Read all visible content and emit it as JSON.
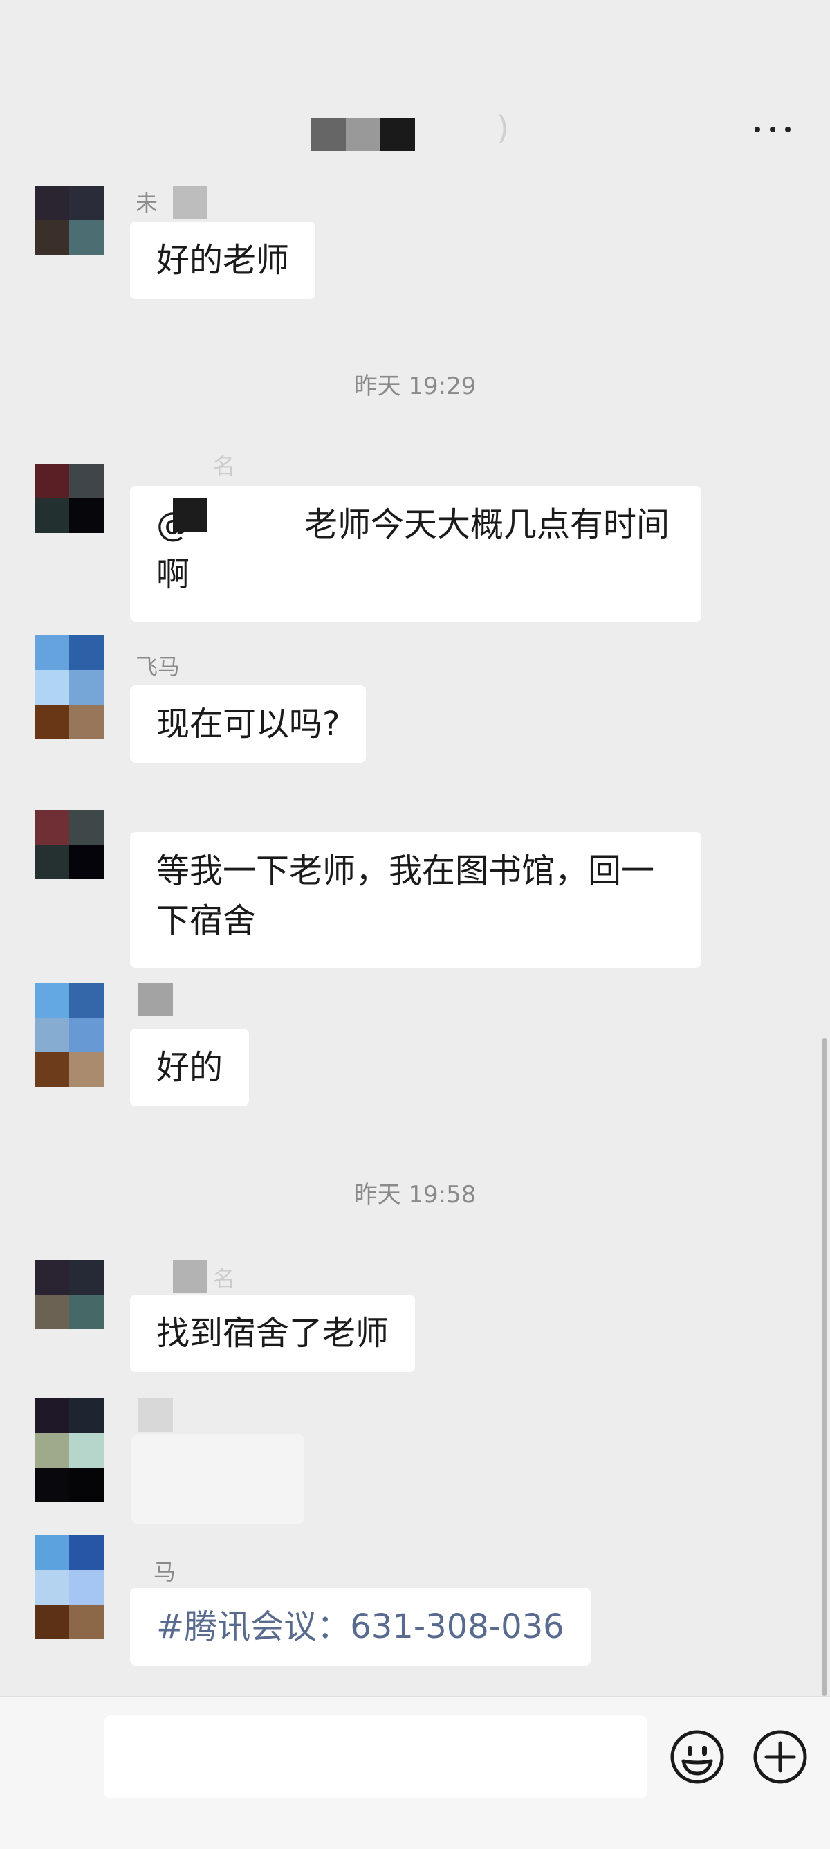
{
  "header": {
    "title_suffix": ")",
    "title_blocks": [
      "#666666",
      "#999999",
      "#1a1a1a"
    ],
    "more_icon": "more-horizontal-icon"
  },
  "timestamps": [
    "昨天 19:29",
    "昨天 19:58"
  ],
  "messages": [
    {
      "sender": "未",
      "text": "好的老师",
      "avatar": [
        "#2b2532",
        "#2a2c3a",
        "#3b2f2a",
        "#4c6d72"
      ]
    },
    {
      "sender": "名",
      "text_prefix": "@",
      "text_line1": "老师今天大概几点有时间",
      "text_line2": "啊",
      "avatar": [
        "#5a1f24",
        "#3f4549",
        "#223030",
        "#07070b"
      ]
    },
    {
      "sender": "飞马",
      "text": "现在可以吗?",
      "avatar": [
        "#65a3de",
        "#2c61a8",
        "#b0d4f4",
        "#76a6d8",
        "#6a3716",
        "#97765a"
      ]
    },
    {
      "sender": "",
      "text_line1": "等我一下老师，我在图书馆，回一",
      "text_line2": "下宿舍",
      "avatar": [
        "#702f35",
        "#3e4849",
        "#253131",
        "#04040a"
      ]
    },
    {
      "sender": "",
      "text": "好的",
      "avatar": [
        "#63a7e3",
        "#3467a9",
        "#87acd2",
        "#679ad4",
        "#6d3c1b",
        "#ab8b6e"
      ]
    },
    {
      "sender": "名",
      "text": "找到宿舍了老师",
      "avatar": [
        "#292332",
        "#252a36",
        "#6b6254",
        "#466967"
      ]
    },
    {
      "sender": "",
      "text": "",
      "avatar": [
        "#1e1829",
        "#1f2431",
        "#9eaa8b",
        "#b6d6cb",
        "#08080d",
        "#050508"
      ]
    },
    {
      "sender": "马",
      "text": "#腾讯会议：631-308-036",
      "avatar": [
        "#5ba2df",
        "#2656a5",
        "#b4d3f0",
        "#a5c6f3",
        "#5d3115",
        "#8c6849"
      ]
    }
  ],
  "bottom": {
    "input_placeholder": "",
    "emoji_icon": "emoji-icon",
    "add_icon": "plus-circle-icon"
  },
  "colors": {
    "background": "#ededed",
    "bubble": "#ffffff",
    "link_text": "#586b8f"
  }
}
